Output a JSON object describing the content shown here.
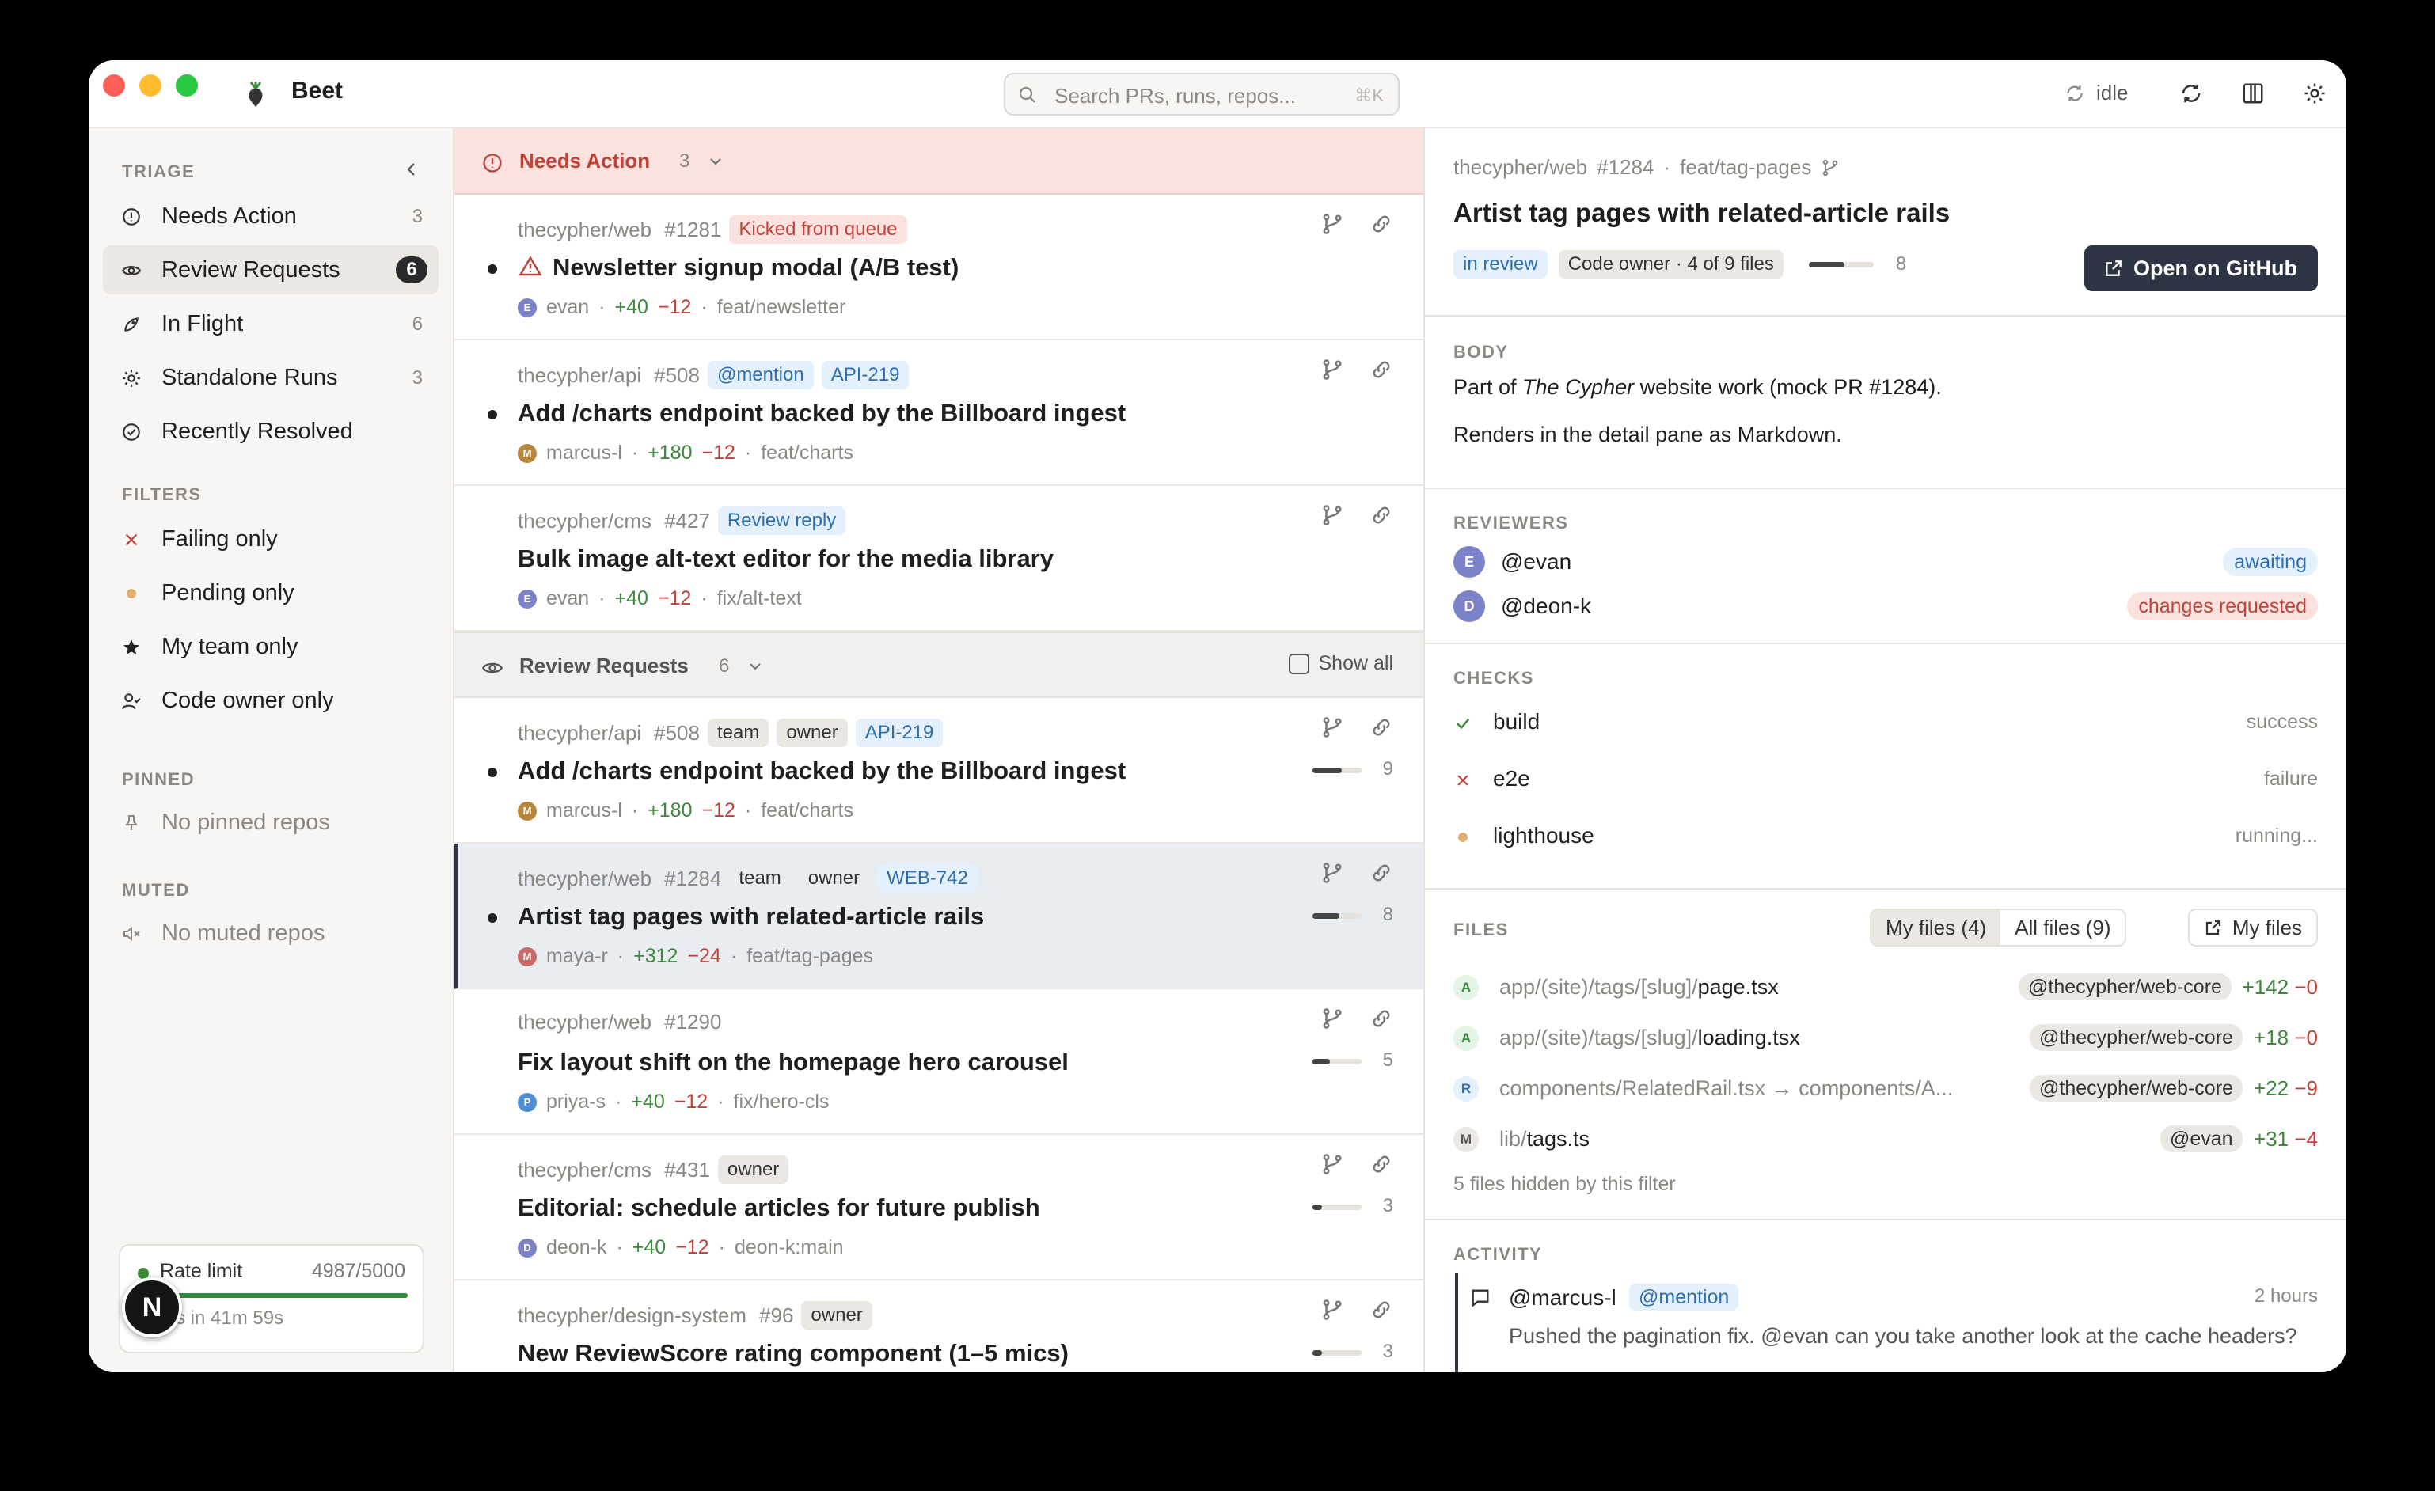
{
  "app": {
    "title": "Beet"
  },
  "search": {
    "placeholder": "Search PRs, runs, repos...",
    "shortcut": "⌘K"
  },
  "toolbar": {
    "status": "idle"
  },
  "sidebar": {
    "triage_label": "TRIAGE",
    "triage": [
      {
        "label": "Needs Action",
        "count": "3",
        "icon": "alert-circle-icon"
      },
      {
        "label": "Review Requests",
        "count": "6",
        "icon": "eye-icon",
        "active": true
      },
      {
        "label": "In Flight",
        "count": "6",
        "icon": "rocket-icon"
      },
      {
        "label": "Standalone Runs",
        "count": "3",
        "icon": "gear-icon"
      },
      {
        "label": "Recently Resolved",
        "count": "",
        "icon": "check-circle-icon"
      }
    ],
    "filters_label": "FILTERS",
    "filters": [
      {
        "label": "Failing only",
        "icon": "x-icon"
      },
      {
        "label": "Pending only",
        "icon": "dot-icon"
      },
      {
        "label": "My team only",
        "icon": "star-icon"
      },
      {
        "label": "Code owner only",
        "icon": "user-check-icon"
      }
    ],
    "pinned_label": "PINNED",
    "pinned_empty": "No pinned repos",
    "muted_label": "MUTED",
    "muted_empty": "No muted repos",
    "rate": {
      "label": "Rate limit",
      "value": "4987/5000",
      "reset": "s in 41m 59s",
      "fraction": 0.9974
    },
    "n_badge": "N"
  },
  "list": {
    "needs_action": {
      "label": "Needs Action",
      "count": "3"
    },
    "needs_items": [
      {
        "repo": "thecypher/web",
        "num": "#1281",
        "tags": [
          {
            "t": "Kicked from queue",
            "c": "red"
          }
        ],
        "title": "Newsletter signup modal (A/B test)",
        "warn": true,
        "unread": true,
        "author": "evan",
        "avc": "#7b82c9",
        "add": "+40",
        "del": "−12",
        "branch": "feat/newsletter"
      },
      {
        "repo": "thecypher/api",
        "num": "#508",
        "tags": [
          {
            "t": "@mention",
            "c": "blue"
          },
          {
            "t": "API-219",
            "c": "blue"
          }
        ],
        "title": "Add /charts endpoint backed by the Billboard ingest",
        "warn": false,
        "unread": true,
        "author": "marcus-l",
        "avc": "#b8863b",
        "add": "+180",
        "del": "−12",
        "branch": "feat/charts"
      },
      {
        "repo": "thecypher/cms",
        "num": "#427",
        "tags": [
          {
            "t": "Review reply",
            "c": "blue"
          }
        ],
        "title": "Bulk image alt-text editor for the media library",
        "warn": false,
        "unread": false,
        "author": "evan",
        "avc": "#7b82c9",
        "add": "+40",
        "del": "−12",
        "branch": "fix/alt-text"
      }
    ],
    "review_requests": {
      "label": "Review Requests",
      "count": "6",
      "show_all": "Show all"
    },
    "review_items": [
      {
        "repo": "thecypher/api",
        "num": "#508",
        "tags": [
          {
            "t": "team",
            "c": "grey"
          },
          {
            "t": "owner",
            "c": "grey"
          },
          {
            "t": "API-219",
            "c": "blue"
          }
        ],
        "title": "Add /charts endpoint backed by the Billboard ingest",
        "unread": true,
        "author": "marcus-l",
        "avc": "#b8863b",
        "add": "+180",
        "del": "−12",
        "branch": "feat/charts",
        "progress": 0.6,
        "pcount": "9"
      },
      {
        "repo": "thecypher/web",
        "num": "#1284",
        "tags": [
          {
            "t": "team",
            "c": "plain"
          },
          {
            "t": "owner",
            "c": "plain"
          },
          {
            "t": "WEB-742",
            "c": "blue"
          }
        ],
        "title": "Artist tag pages with related-article rails",
        "unread": true,
        "selected": true,
        "author": "maya-r",
        "avc": "#c86a6a",
        "add": "+312",
        "del": "−24",
        "branch": "feat/tag-pages",
        "progress": 0.55,
        "pcount": "8"
      },
      {
        "repo": "thecypher/web",
        "num": "#1290",
        "tags": [],
        "title": "Fix layout shift on the homepage hero carousel",
        "unread": false,
        "author": "priya-s",
        "avc": "#4f8fd1",
        "add": "+40",
        "del": "−12",
        "branch": "fix/hero-cls",
        "progress": 0.35,
        "pcount": "5"
      },
      {
        "repo": "thecypher/cms",
        "num": "#431",
        "tags": [
          {
            "t": "owner",
            "c": "grey"
          }
        ],
        "title": "Editorial: schedule articles for future publish",
        "unread": false,
        "author": "deon-k",
        "avc": "#7b82c9",
        "add": "+40",
        "del": "−12",
        "branch": "deon-k:main",
        "progress": 0.2,
        "pcount": "3"
      },
      {
        "repo": "thecypher/design-system",
        "num": "#96",
        "tags": [
          {
            "t": "owner",
            "c": "grey"
          }
        ],
        "title": "New ReviewScore rating component (1–5 mics)",
        "unread": false,
        "author": "",
        "avc": "#999",
        "add": "",
        "del": "",
        "branch": "",
        "progress": 0.2,
        "pcount": "3"
      }
    ]
  },
  "detail": {
    "repo": "thecypher/web",
    "num": "#1284",
    "branch": "feat/tag-pages",
    "title": "Artist tag pages with related-article rails",
    "status_tag": "in review",
    "owner_tag": "Code owner · 4 of 9 files",
    "progress": 0.55,
    "pcount": "8",
    "open_btn": "Open on GitHub",
    "body_label": "BODY",
    "body_p1_pre": "Part of ",
    "body_p1_em": "The Cypher",
    "body_p1_post": " website work (mock PR #1284).",
    "body_p2": "Renders in the detail pane as Markdown.",
    "reviewers_label": "REVIEWERS",
    "reviewers": [
      {
        "initial": "E",
        "name": "@evan",
        "state": "awaiting",
        "cls": "await"
      },
      {
        "initial": "D",
        "name": "@deon-k",
        "state": "changes requested",
        "cls": "chg"
      }
    ],
    "checks_label": "CHECKS",
    "checks": [
      {
        "name": "build",
        "state": "success",
        "icon": "check-icon"
      },
      {
        "name": "e2e",
        "state": "failure",
        "icon": "x-icon"
      },
      {
        "name": "lighthouse",
        "state": "running...",
        "icon": "dot-icon"
      }
    ],
    "files_label": "FILES",
    "seg_my": "My files (4)",
    "seg_all": "All files (9)",
    "my_files_btn": "My files",
    "files": [
      {
        "status": "A",
        "dir": "app/(site)/tags/[slug]/",
        "name": "page.tsx",
        "owner": "@thecypher/web-core",
        "add": "+142",
        "del": "−0"
      },
      {
        "status": "A",
        "dir": "app/(site)/tags/[slug]/",
        "name": "loading.tsx",
        "owner": "@thecypher/web-core",
        "add": "+18",
        "del": "−0"
      },
      {
        "status": "R",
        "dir": "components/RelatedRail.tsx → components/A...",
        "name": "",
        "owner": "@thecypher/web-core",
        "add": "+22",
        "del": "−9"
      },
      {
        "status": "M",
        "dir": "lib/",
        "name": "tags.ts",
        "owner": "@evan",
        "add": "+31",
        "del": "−4"
      }
    ],
    "hidden_note": "5 files hidden by this filter",
    "activity_label": "ACTIVITY",
    "activity": {
      "author": "@marcus-l",
      "tag": "@mention",
      "time": "2 hours",
      "body": "Pushed the pagination fix. @evan can you take another look at the cache headers?"
    }
  },
  "colors": {
    "accent_dark": "#2d3444",
    "alert_bg": "#fbe2df",
    "add": "#3c8a3c",
    "del": "#c0433a"
  }
}
